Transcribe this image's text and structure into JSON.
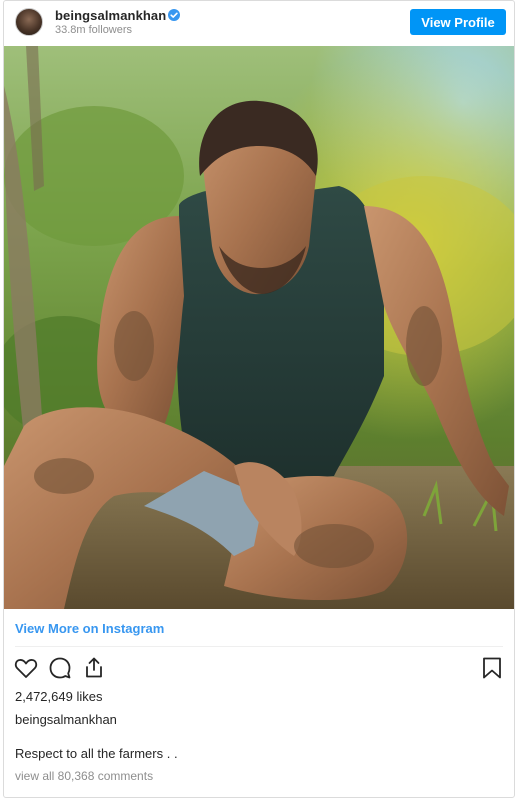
{
  "header": {
    "username": "beingsalmankhan",
    "followers": "33.8m followers",
    "view_profile_label": "View Profile",
    "verified_icon": "verified-badge-icon"
  },
  "post": {
    "image_icon": "post-photo",
    "view_more_label": "View More on Instagram",
    "likes": "2,472,649 likes",
    "caption_user": "beingsalmankhan",
    "caption": "Respect to all the farmers . .",
    "comments_link": "view all 80,368 comments"
  },
  "actions": {
    "like_icon": "heart-icon",
    "comment_icon": "comment-icon",
    "share_icon": "share-icon",
    "save_icon": "bookmark-icon"
  },
  "colors": {
    "accent": "#0095f6",
    "link": "#3897f0",
    "muted": "#8e8e8e"
  }
}
